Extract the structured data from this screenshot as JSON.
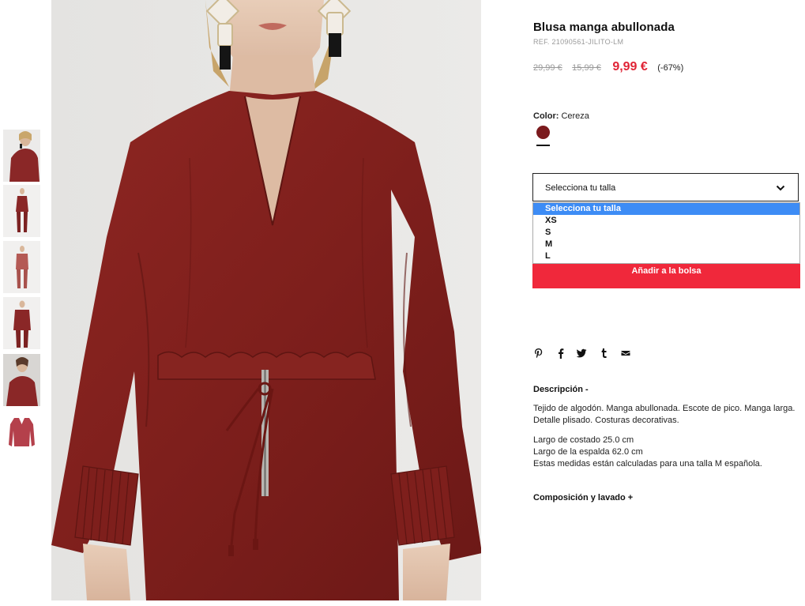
{
  "product": {
    "title": "Blusa manga abullonada",
    "ref": "REF. 21090561-JILITO-LM",
    "prices": {
      "old_1": "29,99 €",
      "old_2": "15,99 €",
      "current": "9,99 €",
      "discount": "(-67%)"
    },
    "color": {
      "label": "Color:",
      "value": "Cereza",
      "swatch_hex": "#7b1a1d"
    }
  },
  "size_select": {
    "current": "Selecciona tu talla",
    "options": [
      "Selecciona tu talla",
      "XS",
      "S",
      "M",
      "L"
    ],
    "highlight_hex": "#3d8cf5"
  },
  "actions": {
    "add_to_bag": "Añadir a la bolsa",
    "accent_hex": "#f0283b"
  },
  "share_icons": [
    "pinterest-icon",
    "facebook-icon",
    "twitter-icon",
    "tumblr-icon",
    "email-icon"
  ],
  "description": {
    "title": "Descripción -",
    "text": "Tejido de algodón. Manga abullonada. Escote de pico. Manga larga. Detalle plisado. Costuras decorativas.",
    "measures": [
      "Largo de costado 25.0 cm",
      "Largo de la espalda 62.0 cm",
      "Estas medidas están calculadas para una talla M española."
    ]
  },
  "composition": {
    "title": "Composición y lavado +"
  },
  "icons": {
    "dropdown": "chevron-down-icon"
  }
}
